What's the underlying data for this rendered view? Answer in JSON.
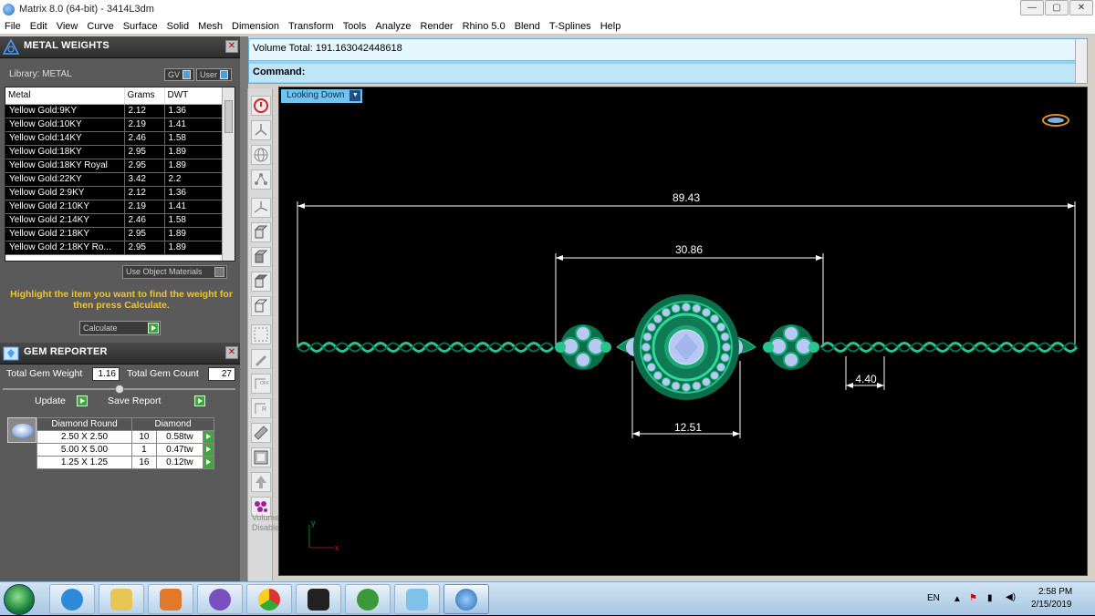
{
  "window": {
    "title": "Matrix 8.0 (64-bit) - 3414L3dm"
  },
  "window_buttons": [
    "—",
    "▢",
    "✕"
  ],
  "menu": [
    "File",
    "Edit",
    "View",
    "Curve",
    "Surface",
    "Solid",
    "Mesh",
    "Dimension",
    "Transform",
    "Tools",
    "Analyze",
    "Render",
    "Rhino 5.0",
    "Blend",
    "T-Splines",
    "Help"
  ],
  "metal_weights": {
    "title": "METAL WEIGHTS",
    "library_label": "Library: METAL",
    "gv_label": "GV",
    "user_label": "User",
    "columns": [
      "Metal",
      "Grams",
      "DWT"
    ],
    "rows": [
      [
        "Yellow Gold:9KY",
        "2.12",
        "1.36"
      ],
      [
        "Yellow Gold:10KY",
        "2.19",
        "1.41"
      ],
      [
        "Yellow Gold:14KY",
        "2.46",
        "1.58"
      ],
      [
        "Yellow Gold:18KY",
        "2.95",
        "1.89"
      ],
      [
        "Yellow Gold:18KY Royal",
        "2.95",
        "1.89"
      ],
      [
        "Yellow Gold:22KY",
        "3.42",
        "2.2"
      ],
      [
        "Yellow Gold 2:9KY",
        "2.12",
        "1.36"
      ],
      [
        "Yellow Gold 2:10KY",
        "2.19",
        "1.41"
      ],
      [
        "Yellow Gold 2:14KY",
        "2.46",
        "1.58"
      ],
      [
        "Yellow Gold 2:18KY",
        "2.95",
        "1.89"
      ],
      [
        "Yellow Gold 2:18KY Ro...",
        "2.95",
        "1.89"
      ]
    ],
    "use_object_materials": "Use Object Materials",
    "hint": "Highlight the item you want to find the weight for then press Calculate.",
    "calculate": "Calculate"
  },
  "gem_reporter": {
    "title": "GEM REPORTER",
    "total_weight_label": "Total Gem Weight",
    "total_weight": "1.16",
    "total_count_label": "Total Gem Count",
    "total_count": "27",
    "update": "Update",
    "save_report": "Save Report",
    "columns": [
      "Diamond Round",
      "Diamond"
    ],
    "rows": [
      [
        "2.50 X 2.50",
        "10",
        "0.58tw"
      ],
      [
        "5.00 X 5.00",
        "1",
        "0.47tw"
      ],
      [
        "1.25 X 1.25",
        "16",
        "0.12tw"
      ]
    ]
  },
  "command": {
    "volume": "Volume Total: 191.163042448618",
    "prompt": "Command:"
  },
  "viewport": {
    "label": "Looking Down",
    "dimensions": [
      "89.43",
      "30.86",
      "12.51",
      "4.40"
    ],
    "axis_y": "y",
    "axis_x": "x",
    "colors": {
      "metal": "#0e8a5e",
      "metal_light": "#27c48e",
      "stone": "#b9c8f2",
      "dimension": "#ffffff"
    }
  },
  "toolbar": {
    "status": "Volume Disabled"
  },
  "taskbar": {
    "lang": "EN",
    "time": "2:58 PM",
    "date": "2/15/2019"
  }
}
